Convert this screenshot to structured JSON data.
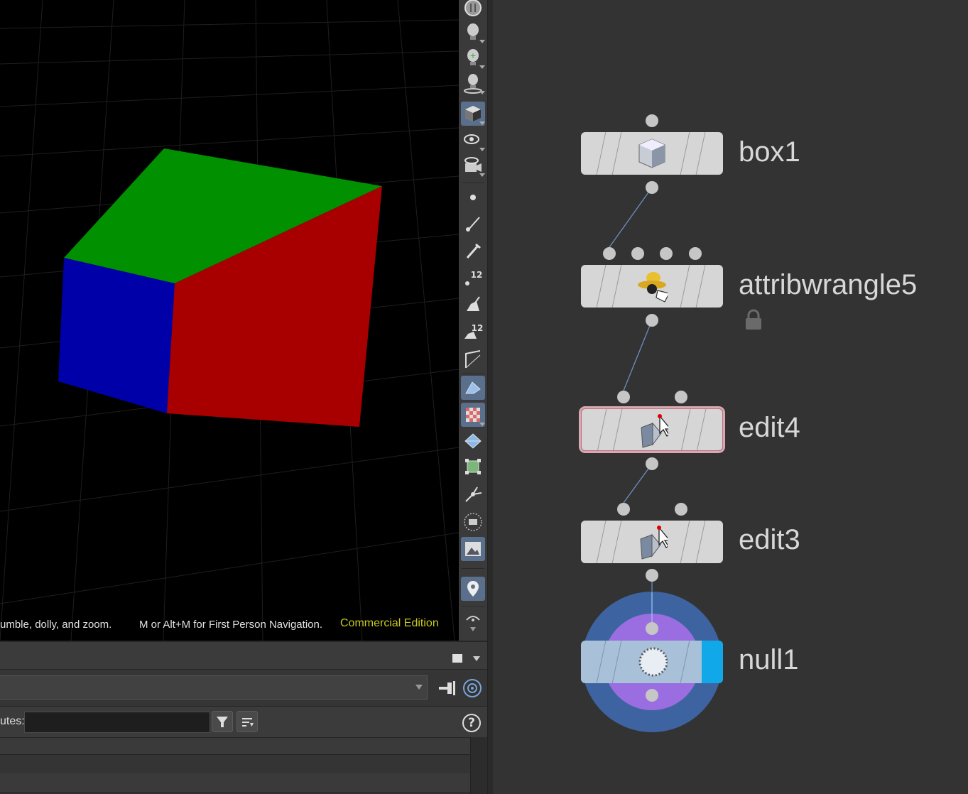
{
  "viewport": {
    "status_hint": "umble, dolly, and zoom.",
    "status_hint2": "M or Alt+M for First Person Navigation.",
    "edition": "Commercial Edition",
    "colors": {
      "top": "#009000",
      "left": "#0000a8",
      "right": "#a80000",
      "background": "#000000"
    }
  },
  "toolbar": {
    "tools": [
      "display-options-icon",
      "light-icon",
      "light-add-icon",
      "camera-light-icon",
      "shaded-mode-icon",
      "ghost-eye-icon",
      "camera-eye-icon",
      "point-icon",
      "brush-icon",
      "pen-icon",
      "point-numbers-icon",
      "prim-icon",
      "prim-numbers-icon",
      "normals-icon",
      "wireframe-icon",
      "uv-checker-icon",
      "snap-grid-icon",
      "transform-handle-icon",
      "pivot-icon",
      "sphere-ghost-icon",
      "background-image-icon",
      "pin-map-icon",
      "camera-orbit-icon"
    ]
  },
  "bottom": {
    "attributes_label": "utes:",
    "attributes_value": ""
  },
  "network": {
    "nodes": [
      {
        "name": "box1",
        "type": "box"
      },
      {
        "name": "attribwrangle5",
        "type": "attribwrangle",
        "locked": true
      },
      {
        "name": "edit4",
        "type": "edit",
        "selected": true
      },
      {
        "name": "edit3",
        "type": "edit"
      },
      {
        "name": "null1",
        "type": "null",
        "display": true
      }
    ]
  }
}
